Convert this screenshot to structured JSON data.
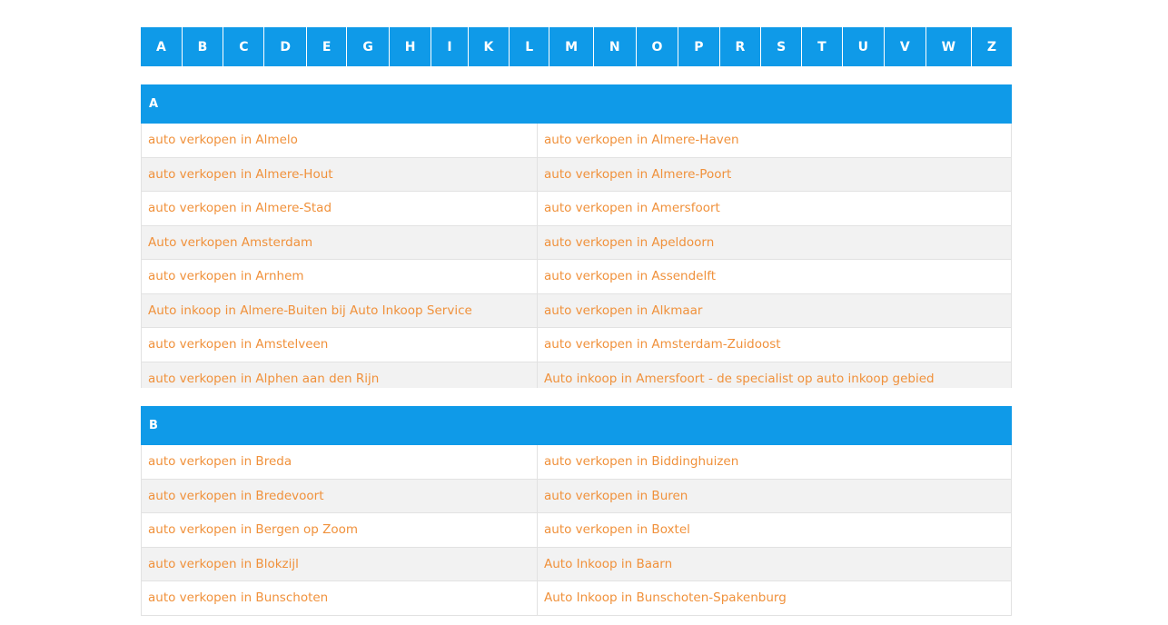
{
  "alphabet": [
    "A",
    "B",
    "C",
    "D",
    "E",
    "G",
    "H",
    "I",
    "K",
    "L",
    "M",
    "N",
    "O",
    "P",
    "R",
    "S",
    "T",
    "U",
    "V",
    "W",
    "Z"
  ],
  "sections": [
    {
      "letter": "A",
      "rows": [
        [
          "auto verkopen in Almelo",
          "auto verkopen in Almere-Haven"
        ],
        [
          "auto verkopen in Almere-Hout",
          "auto verkopen in Almere-Poort"
        ],
        [
          "auto verkopen in Almere-Stad",
          "auto verkopen in Amersfoort"
        ],
        [
          "Auto verkopen Amsterdam",
          "auto verkopen in Apeldoorn"
        ],
        [
          "auto verkopen in Arnhem",
          "auto verkopen in Assendelft"
        ],
        [
          "Auto inkoop in Almere-Buiten bij Auto Inkoop Service",
          "auto verkopen in Alkmaar"
        ],
        [
          "auto verkopen in Amstelveen",
          "auto verkopen in Amsterdam-Zuidoost"
        ],
        [
          "auto verkopen in Alphen aan den Rijn",
          "Auto inkoop in Amersfoort - de specialist op auto inkoop gebied"
        ]
      ]
    },
    {
      "letter": "B",
      "rows": [
        [
          "auto verkopen in Breda",
          "auto verkopen in Biddinghuizen"
        ],
        [
          "auto verkopen in Bredevoort",
          "auto verkopen in Buren"
        ],
        [
          "auto verkopen in Bergen op Zoom",
          "auto verkopen in Boxtel"
        ],
        [
          "auto verkopen in Blokzijl",
          "Auto Inkoop in Baarn"
        ],
        [
          "auto verkopen in Bunschoten",
          "Auto Inkoop in Bunschoten-Spakenburg"
        ]
      ]
    }
  ]
}
